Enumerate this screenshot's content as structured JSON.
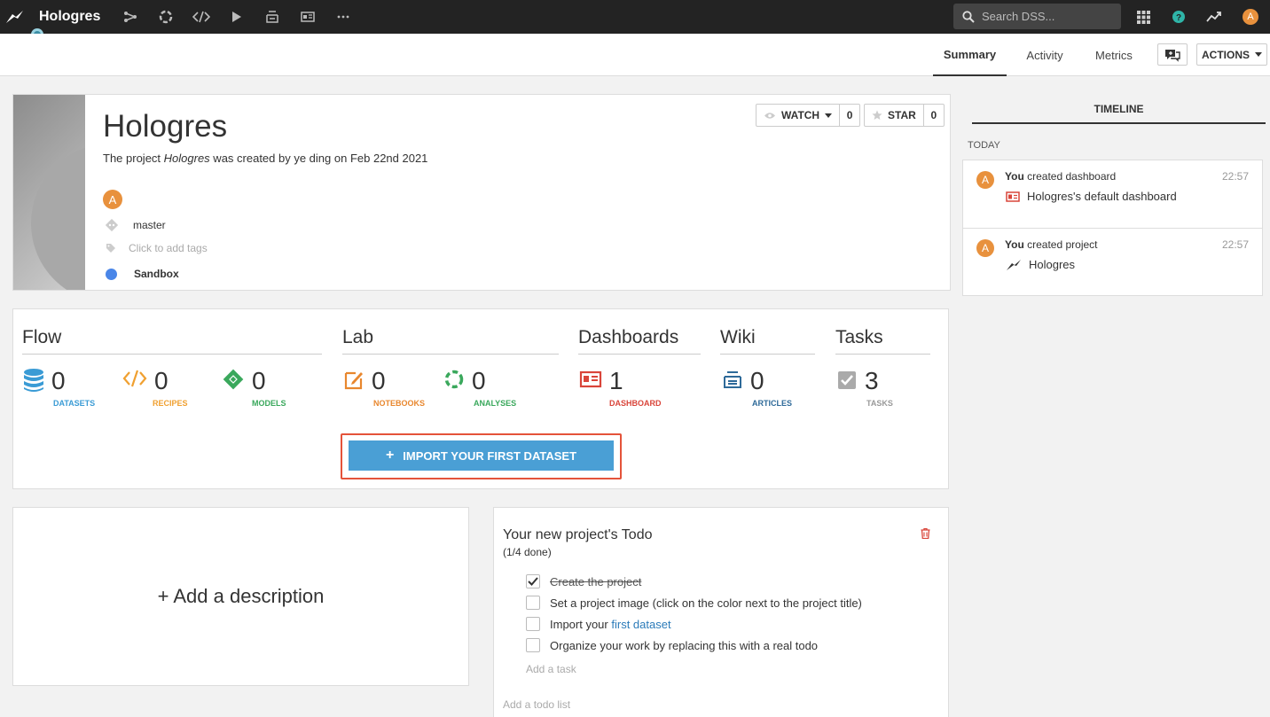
{
  "topbar": {
    "project_name": "Hologres",
    "search_placeholder": "Search DSS...",
    "user_initial": "A"
  },
  "subnav": {
    "tabs": [
      "Summary",
      "Activity",
      "Metrics"
    ],
    "active_tab": "Summary",
    "actions_label": "ACTIONS"
  },
  "header": {
    "title": "Hologres",
    "sub_prefix": "The project ",
    "sub_project": "Hologres",
    "sub_suffix": " was created by ye ding on Feb 22nd 2021",
    "owner_initial": "A",
    "branch": "master",
    "tags_placeholder": "Click to add tags",
    "status": "Sandbox",
    "status_color": "#4a86e8",
    "watch_label": "WATCH",
    "watch_count": "0",
    "star_label": "STAR",
    "star_count": "0"
  },
  "sections": {
    "flow": "Flow",
    "lab": "Lab",
    "dashboards": "Dashboards",
    "wiki": "Wiki",
    "tasks": "Tasks"
  },
  "stats": {
    "datasets": {
      "value": "0",
      "label": "DATASETS",
      "color": "#3a9bd5"
    },
    "recipes": {
      "value": "0",
      "label": "RECIPES",
      "color": "#f0a030"
    },
    "models": {
      "value": "0",
      "label": "MODELS",
      "color": "#3aa85c"
    },
    "notebooks": {
      "value": "0",
      "label": "NOTEBOOKS",
      "color": "#e8872e"
    },
    "analyses": {
      "value": "0",
      "label": "ANALYSES",
      "color": "#3aa85c"
    },
    "dashboard": {
      "value": "1",
      "label": "DASHBOARD",
      "color": "#d9453a"
    },
    "articles": {
      "value": "0",
      "label": "ARTICLES",
      "color": "#2e6a99"
    },
    "tasks": {
      "value": "3",
      "label": "TASKS",
      "color": "#999999"
    }
  },
  "import_button": "IMPORT YOUR FIRST DATASET",
  "description_placeholder": "+ Add a description",
  "todo": {
    "title": "Your new project's Todo",
    "progress": "(1/4 done)",
    "items": [
      {
        "text": "Create the project",
        "done": true
      },
      {
        "text": "Set a project image (click on the color next to the project title)",
        "done": false
      },
      {
        "text_prefix": "Import your ",
        "link": "first dataset",
        "done": false
      },
      {
        "text": "Organize your work by replacing this with a real todo",
        "done": false
      }
    ],
    "add_task": "Add a task",
    "add_list": "Add a todo list"
  },
  "timeline": {
    "title": "TIMELINE",
    "group": "TODAY",
    "events": [
      {
        "actor": "You",
        "action": " created dashboard",
        "time": "22:57",
        "object": "Hologres's default dashboard",
        "initial": "A"
      },
      {
        "actor": "You",
        "action": " created project",
        "time": "22:57",
        "object": "Hologres",
        "initial": "A"
      }
    ]
  }
}
